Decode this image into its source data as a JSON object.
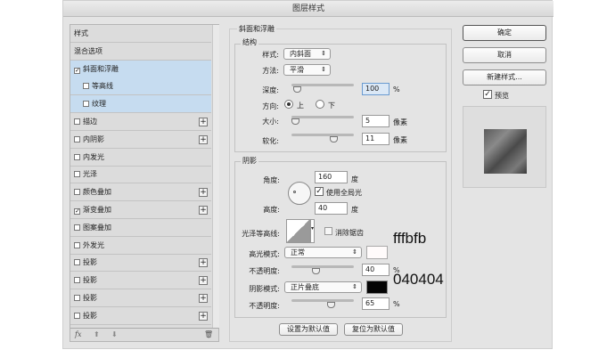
{
  "window": {
    "title": "图层样式"
  },
  "sidebar": {
    "items": [
      {
        "label": "样式",
        "checkbox": false,
        "checked": false,
        "plus": false,
        "selected": false,
        "indent": false
      },
      {
        "label": "混合选项",
        "checkbox": false,
        "checked": false,
        "plus": false,
        "selected": false,
        "indent": false
      },
      {
        "label": "斜面和浮雕",
        "checkbox": true,
        "checked": true,
        "plus": false,
        "selected": true,
        "indent": false
      },
      {
        "label": "等高线",
        "checkbox": true,
        "checked": false,
        "plus": false,
        "selected": true,
        "indent": true
      },
      {
        "label": "纹理",
        "checkbox": true,
        "checked": false,
        "plus": false,
        "selected": true,
        "indent": true
      },
      {
        "label": "描边",
        "checkbox": true,
        "checked": false,
        "plus": true,
        "selected": false,
        "indent": false
      },
      {
        "label": "内阴影",
        "checkbox": true,
        "checked": false,
        "plus": true,
        "selected": false,
        "indent": false
      },
      {
        "label": "内发光",
        "checkbox": true,
        "checked": false,
        "plus": false,
        "selected": false,
        "indent": false
      },
      {
        "label": "光泽",
        "checkbox": true,
        "checked": false,
        "plus": false,
        "selected": false,
        "indent": false
      },
      {
        "label": "颜色叠加",
        "checkbox": true,
        "checked": false,
        "plus": true,
        "selected": false,
        "indent": false
      },
      {
        "label": "渐变叠加",
        "checkbox": true,
        "checked": true,
        "plus": true,
        "selected": false,
        "indent": false
      },
      {
        "label": "图案叠加",
        "checkbox": true,
        "checked": false,
        "plus": false,
        "selected": false,
        "indent": false
      },
      {
        "label": "外发光",
        "checkbox": true,
        "checked": false,
        "plus": false,
        "selected": false,
        "indent": false
      },
      {
        "label": "投影",
        "checkbox": true,
        "checked": false,
        "plus": true,
        "selected": false,
        "indent": false
      },
      {
        "label": "投影",
        "checkbox": true,
        "checked": false,
        "plus": true,
        "selected": false,
        "indent": false
      },
      {
        "label": "投影",
        "checkbox": true,
        "checked": false,
        "plus": true,
        "selected": false,
        "indent": false
      },
      {
        "label": "投影",
        "checkbox": true,
        "checked": false,
        "plus": true,
        "selected": false,
        "indent": false
      }
    ],
    "footer": {
      "fx": "fx"
    }
  },
  "bevel": {
    "title": "斜面和浮雕",
    "structure": {
      "title": "结构",
      "style_label": "样式:",
      "style_value": "内斜面",
      "technique_label": "方法:",
      "technique_value": "平滑",
      "depth_label": "深度:",
      "depth_value": "100",
      "depth_unit": "%",
      "direction_label": "方向:",
      "direction_up": "上",
      "direction_down": "下",
      "direction_selected": "上",
      "size_label": "大小:",
      "size_value": "5",
      "size_unit": "像素",
      "soften_label": "软化:",
      "soften_value": "11",
      "soften_unit": "像素"
    },
    "shading": {
      "title": "阴影",
      "angle_label": "角度:",
      "angle_value": "160",
      "angle_unit": "度",
      "global_light_label": "使用全局光",
      "global_light_checked": true,
      "altitude_label": "高度:",
      "altitude_value": "40",
      "altitude_unit": "度",
      "gloss_label": "光泽等高线:",
      "antialias_label": "消除锯齿",
      "antialias_checked": false,
      "highlight_label": "高光模式:",
      "highlight_value": "正常",
      "highlight_color": "#fffbfb",
      "highlight_opacity_label": "不透明度:",
      "highlight_opacity_value": "40",
      "highlight_opacity_unit": "%",
      "shadow_label": "阴影模式:",
      "shadow_value": "正片叠底",
      "shadow_color": "#040404",
      "shadow_opacity_label": "不透明度:",
      "shadow_opacity_value": "65",
      "shadow_opacity_unit": "%"
    },
    "make_default": "设置为默认值",
    "reset_default": "复位为默认值"
  },
  "annotations": {
    "highlight_hex": "fffbfb",
    "shadow_hex": "040404"
  },
  "actions": {
    "ok": "确定",
    "cancel": "取消",
    "new_style": "新建样式...",
    "preview_label": "预览",
    "preview_checked": true
  }
}
